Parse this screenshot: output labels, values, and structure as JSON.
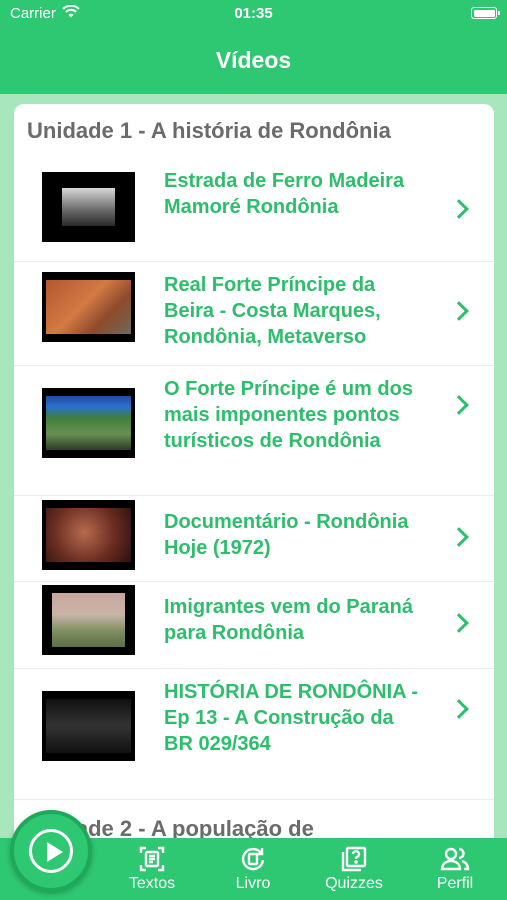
{
  "status_bar": {
    "carrier": "Carrier",
    "time": "01:35"
  },
  "nav": {
    "title": "Vídeos"
  },
  "sections": [
    {
      "title": "Unidade 1 - A história de Rondônia"
    },
    {
      "title": "Unidade 2 -  A população de"
    }
  ],
  "videos": [
    {
      "title": "Estrada de Ferro Madeira Mamoré Rondônia"
    },
    {
      "title": "Real Forte Príncipe da Beira - Costa Marques, Rondônia, Metaverso"
    },
    {
      "title": "O Forte Príncipe é um dos mais imponentes pontos turísticos de Rondônia"
    },
    {
      "title": "Documentário - Rondônia Hoje (1972)"
    },
    {
      "title": "Imigrantes vem do Paraná para Rondônia"
    },
    {
      "title": "HISTÓRIA DE RONDÔNIA - Ep 13 - A Construção da BR 029/364"
    }
  ],
  "tabs": [
    {
      "label": "Textos",
      "icon": "document-scan-icon"
    },
    {
      "label": "Livro",
      "icon": "book-refresh-icon"
    },
    {
      "label": "Quizzes",
      "icon": "question-book-icon"
    },
    {
      "label": "Perfil",
      "icon": "people-icon"
    }
  ],
  "colors": {
    "accent": "#2fc872",
    "title_green": "#2dbe6c",
    "section_gray": "#6b6b6b"
  }
}
